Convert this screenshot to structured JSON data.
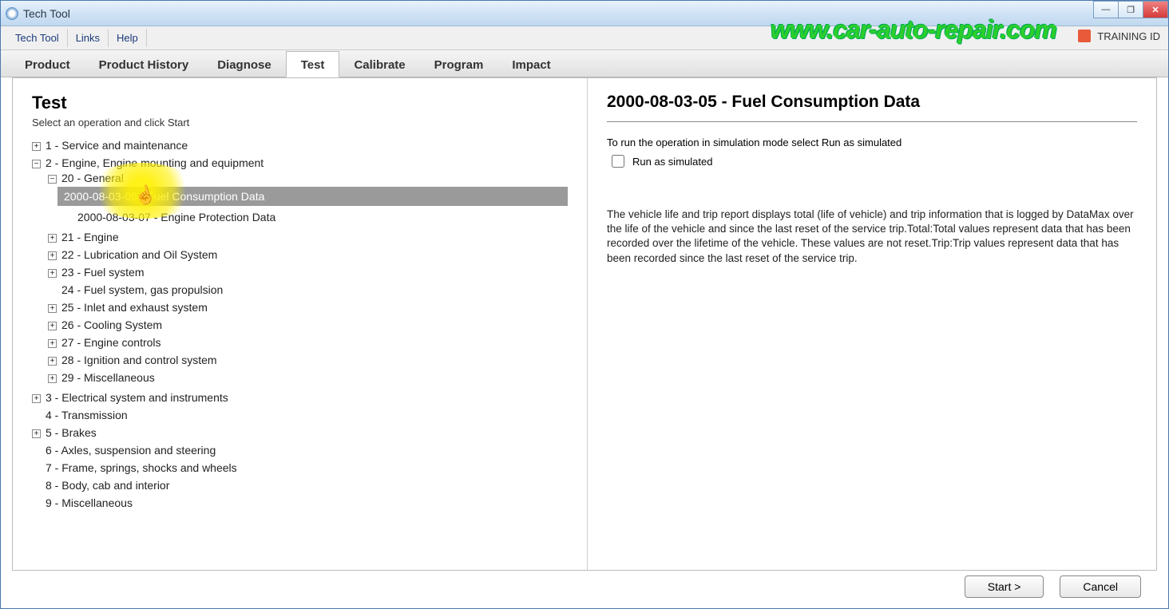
{
  "window": {
    "title": "Tech Tool"
  },
  "watermark": "www.car-auto-repair.com",
  "menubar": {
    "items": [
      "Tech Tool",
      "Links",
      "Help"
    ],
    "training_id": "TRAINING ID"
  },
  "tabs": [
    "Product",
    "Product History",
    "Diagnose",
    "Test",
    "Calibrate",
    "Program",
    "Impact"
  ],
  "active_tab": "Test",
  "left": {
    "heading": "Test",
    "subtitle": "Select an operation and click Start",
    "tree": {
      "n1": "1 - Service and maintenance",
      "n2": "2 - Engine, Engine mounting and equipment",
      "n20": "20 - General",
      "n20a": "2000-08-03-05 - Fuel Consumption Data",
      "n20b": "2000-08-03-07 - Engine Protection Data",
      "n21": "21 - Engine",
      "n22": "22 - Lubrication and Oil System",
      "n23": "23 - Fuel system",
      "n24": "24 - Fuel system, gas propulsion",
      "n25": "25 - Inlet and exhaust system",
      "n26": "26 - Cooling System",
      "n27": "27 - Engine controls",
      "n28": "28 - Ignition and control system",
      "n29": "29 - Miscellaneous",
      "n3": "3 - Electrical system and instruments",
      "n4": "4 - Transmission",
      "n5": "5 - Brakes",
      "n6": "6 - Axles, suspension and steering",
      "n7": "7 - Frame, springs, shocks and wheels",
      "n8": "8 - Body, cab and interior",
      "n9": "9 - Miscellaneous"
    }
  },
  "right": {
    "heading": "2000-08-03-05 - Fuel Consumption Data",
    "instruction": "To run the operation in simulation mode select Run as simulated",
    "checkbox_label": "Run as simulated",
    "description": "The vehicle life and trip report displays total (life of vehicle) and trip information that is logged by DataMax over the life of the vehicle and since the last reset of the service trip.Total:Total values represent data that has been recorded over the lifetime of the vehicle. These values are not reset.Trip:Trip values represent data that has been recorded since the last reset of the service trip."
  },
  "footer": {
    "start": "Start >",
    "cancel": "Cancel"
  },
  "glyphs": {
    "plus": "+",
    "minus": "−",
    "min": "—",
    "restore": "❐",
    "close": "✕",
    "hand": "☝"
  }
}
